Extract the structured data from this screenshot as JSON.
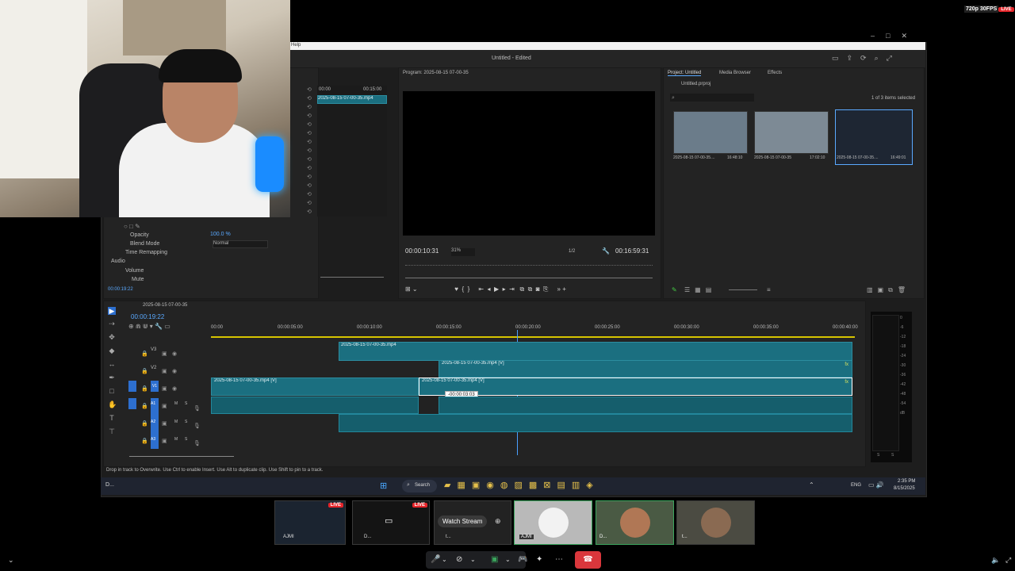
{
  "stream": {
    "badge": "720p 30FPS",
    "live_label": "LIVE"
  },
  "app": {
    "title": "Untitled - Edited",
    "menu_help": "Help"
  },
  "source_panel": {
    "clip_name": "2025-08-15 07-00-35.mp4",
    "time_start": "00:00",
    "time_end": "00:15:00",
    "opacity_label": "Opacity",
    "opacity_value": "100.0 %",
    "blend_label": "Blend Mode",
    "blend_value": "Normal",
    "time_remap_label": "Time Remapping",
    "audio_label": "Audio",
    "volume_label": "Volume",
    "mute_label": "Mute",
    "timecode": "00:00:19:22"
  },
  "program": {
    "title": "Program: 2025-08-15 07-00-35",
    "timecode_in": "00:00:10:31",
    "zoom": "31%",
    "resolution": "1/2",
    "timecode_out": "00:16:59:31"
  },
  "project": {
    "tabs": [
      "Project: Untitled",
      "Media Browser",
      "Effects"
    ],
    "file": "Untitled.prproj",
    "selection": "1 of 3 items selected",
    "items": [
      {
        "name": "2025-08-15 07-00-35....",
        "duration": "16:48:10"
      },
      {
        "name": "2025-08-15 07-00-35",
        "duration": "17:02:10"
      },
      {
        "name": "2025-08-15 07-00-35....",
        "duration": "16:49:01"
      }
    ]
  },
  "timeline": {
    "sequence": "2025-08-15 07-00-35",
    "timecode": "00:00:19:22",
    "ruler": [
      "00:00",
      "00:00:05:00",
      "00:00:10:00",
      "00:00:15:00",
      "00:00:20:00",
      "00:00:25:00",
      "00:00:30:00",
      "00:00:35:00",
      "00:00:40:00"
    ],
    "tracks_video": [
      "V3",
      "V2",
      "V1"
    ],
    "tracks_audio": [
      "A1",
      "A2",
      "A3"
    ],
    "track_flags": [
      "M",
      "S"
    ],
    "clip_v3": "2025-08-15 07-00-35.mp4",
    "clip_v2": "2025-08-15 07-00-35.mp4 [V]",
    "clip_v1a": "2025-08-15 07-00-35.mp4 [V]",
    "clip_v1b": "2025-08-15 07-00-35.mp4 [V]",
    "drag_tooltip": "-00:00:03:03",
    "fx": "fx"
  },
  "meter_scale": [
    "0",
    "-6",
    "-12",
    "-18",
    "-24",
    "-30",
    "-36",
    "-42",
    "-48",
    "-54",
    "dB"
  ],
  "meter_bottom": [
    "S",
    "S"
  ],
  "status_hint": "Drop in track to Overwrite. Use Ctrl to enable Insert. Use Alt to duplicate clip. Use Shift to pin to a track.",
  "taskbar": {
    "search": "Search",
    "lang": "ENG",
    "time": "2:35 PM",
    "date": "8/15/2025",
    "left_label": "D..."
  },
  "call": {
    "watch_stream": "Watch Stream",
    "tiles": [
      {
        "name": "AJMI",
        "live": "LIVE"
      },
      {
        "name": "D...",
        "live": "LIVE"
      },
      {
        "name": "t..."
      },
      {
        "name": "AJMI"
      },
      {
        "name": "D..."
      },
      {
        "name": "t..."
      }
    ]
  }
}
